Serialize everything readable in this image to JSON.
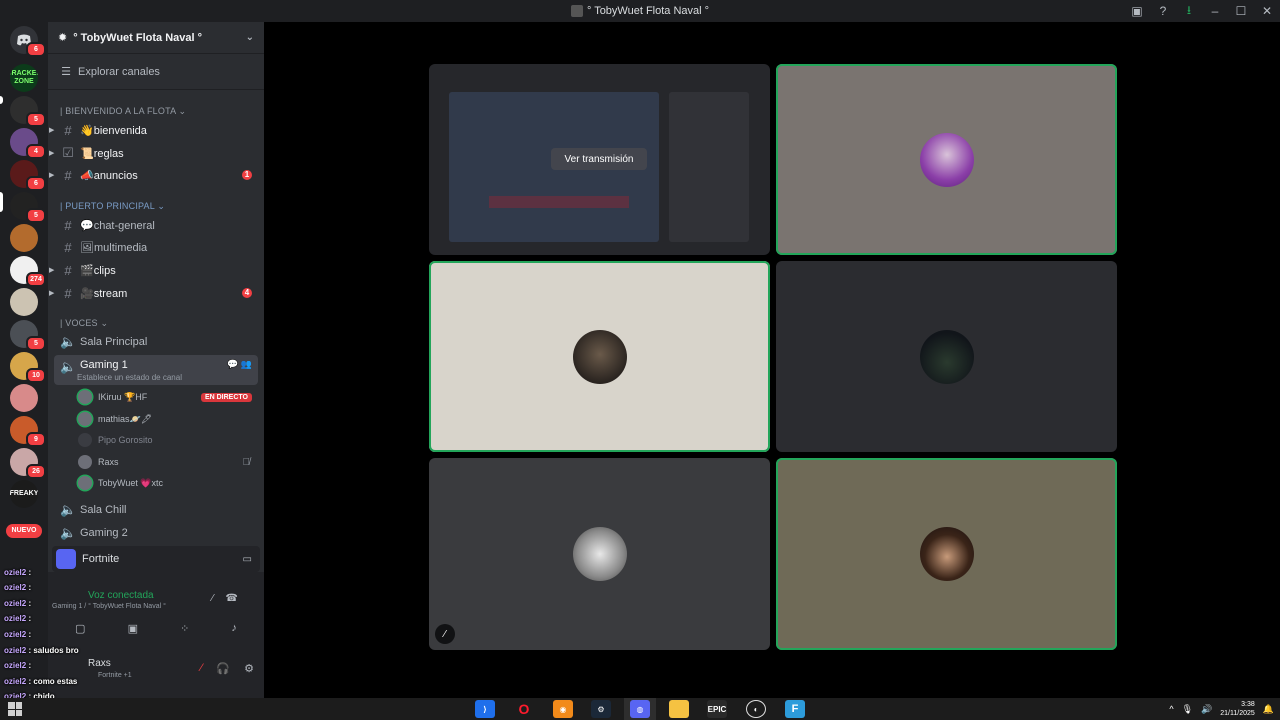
{
  "window": {
    "title": "° TobyWuet Flota Naval °"
  },
  "rail": {
    "servers": [
      {
        "icon": "discord-home-icon",
        "badge": "6"
      },
      {
        "icon": "server-cracked-zone",
        "label": "CRACKED ZONE",
        "badge": ""
      },
      {
        "icon": "server-avatar",
        "badge": "5"
      },
      {
        "icon": "server-avatar",
        "badge": "4"
      },
      {
        "icon": "server-avatar",
        "badge": "6"
      },
      {
        "icon": "server-avatar",
        "badge": "5"
      },
      {
        "icon": "server-avatar",
        "badge": ""
      },
      {
        "icon": "server-avatar",
        "badge": "274"
      },
      {
        "icon": "server-avatar",
        "badge": ""
      },
      {
        "icon": "server-avatar",
        "badge": "5"
      },
      {
        "icon": "server-avatar",
        "badge": "10"
      },
      {
        "icon": "server-avatar",
        "badge": ""
      },
      {
        "icon": "server-avatar",
        "badge": "9"
      },
      {
        "icon": "server-avatar",
        "badge": "26"
      },
      {
        "icon": "server-freaky",
        "label": "FREAKY",
        "badge": ""
      }
    ],
    "nuevo_label": "NUEVO"
  },
  "sidebar": {
    "server_name": "° TobyWuet Flota Naval °",
    "explore_label": "Explorar canales",
    "categories": {
      "welcome": "| BIENVENIDO A LA FLOTA",
      "main": "| PUERTO PRINCIPAL",
      "voice": "| VOCES"
    },
    "channels": {
      "bienvenida": "👋bienvenida",
      "reglas": "📜reglas",
      "anuncios": "📣anuncios",
      "anuncios_badge": "1",
      "chat_general": "💬chat-general",
      "multimedia": "🖼multimedia",
      "clips": "🎬clips",
      "stream": "🎥stream",
      "stream_badge": "4"
    },
    "voice_channels": {
      "sala_principal": "Sala Principal",
      "gaming1": "Gaming 1",
      "gaming1_status": "Establece un estado de canal",
      "sala_chill": "Sala Chill",
      "gaming2": "Gaming 2"
    },
    "voice_users": [
      {
        "name": "IKiruu 🏆HF",
        "live": "EN DIRECTO"
      },
      {
        "name": "mathias🪐🖋",
        "live": ""
      },
      {
        "name": "Pipo Gorosito",
        "live": ""
      },
      {
        "name": "Raxs",
        "live": ""
      },
      {
        "name": "TobyWuet 💗xtc",
        "live": ""
      }
    ],
    "activity": {
      "game": "Fortnite"
    },
    "voice_connection": {
      "status": "Voz conectada",
      "detail": "Gaming 1 / ° TobyWuet Flota Naval °"
    },
    "user": {
      "name": "Raxs",
      "status": "Fortnite +1"
    }
  },
  "overlay": {
    "lines": [
      {
        "name": "oziel2",
        "text": ":"
      },
      {
        "name": "oziel2",
        "text": ":"
      },
      {
        "name": "oziel2",
        "text": ":"
      },
      {
        "name": "oziel2",
        "text": ":"
      },
      {
        "name": "oziel2",
        "text": ":"
      },
      {
        "name": "oziel2",
        "text": ": saludos bro"
      },
      {
        "name": "oziel2",
        "text": ":"
      },
      {
        "name": "oziel2",
        "text": ": como estas"
      },
      {
        "name": "oziel2",
        "text": ": chido"
      }
    ]
  },
  "stage": {
    "watch_stream_label": "Ver transmisión",
    "colors": {
      "tile2": "#7a7470",
      "tile3": "#d8d4cb",
      "tile4": "#2b2c30",
      "tile5": "#3a3b3e",
      "tile6": "#6f6a57",
      "speaking": "#23a55a"
    }
  },
  "taskbar": {
    "apps": [
      "vscode-icon",
      "opera-icon",
      "fl-studio-icon",
      "steam-icon",
      "discord-icon",
      "file-explorer-icon",
      "epic-games-icon",
      "obs-icon",
      "fortnite-icon"
    ],
    "epic_label": "EPIC",
    "time": "3:38",
    "date": "21/11/2025"
  }
}
